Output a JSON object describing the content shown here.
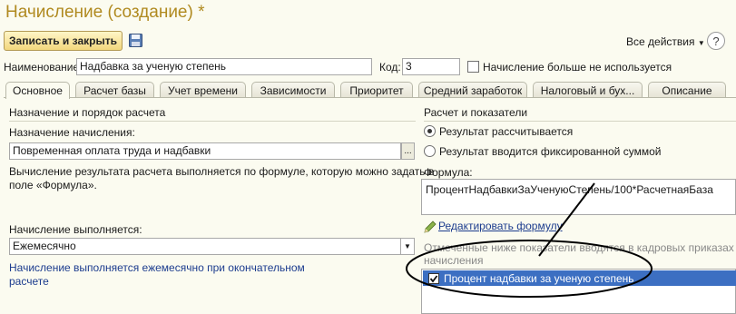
{
  "window": {
    "title": "Начисление (создание) *"
  },
  "toolbar": {
    "save_close_label": "Записать и закрыть",
    "all_actions_label": "Все действия",
    "help_label": "?"
  },
  "header_fields": {
    "name_label": "Наименование:",
    "name_value": "Надбавка за ученую степень",
    "code_label": "Код:",
    "code_value": "3",
    "unused_checkbox_label": "Начисление больше не используется"
  },
  "tabs": [
    {
      "label": "Основное",
      "active": true
    },
    {
      "label": "Расчет базы",
      "active": false
    },
    {
      "label": "Учет времени",
      "active": false
    },
    {
      "label": "Зависимости",
      "active": false
    },
    {
      "label": "Приоритет",
      "active": false
    },
    {
      "label": "Средний заработок",
      "active": false
    },
    {
      "label": "Налоговый и бух...",
      "active": false
    },
    {
      "label": "Описание",
      "active": false
    }
  ],
  "left_panel": {
    "section_title": "Назначение и порядок расчета",
    "purpose_label": "Назначение начисления:",
    "purpose_value": "Повременная оплата труда и надбавки",
    "formula_desc_line1": "Вычисление результата расчета выполняется по формуле, которую можно задать в",
    "formula_desc_line2": "поле «Формула».",
    "frequency_label": "Начисление выполняется:",
    "frequency_value": "Ежемесячно",
    "frequency_desc_line1": "Начисление выполняется ежемесячно при окончательном",
    "frequency_desc_line2": "расчете",
    "ellipsis": "..."
  },
  "right_panel": {
    "section_title": "Расчет и показатели",
    "radio_calculated": "Результат рассчитывается",
    "radio_fixed": "Результат вводится фиксированной суммой",
    "formula_label": "Формула:",
    "formula_value": "ПроцентНадбавкиЗаУченуюСтепень/100*РасчетнаяБаза",
    "edit_formula_link": "Редактировать формулу",
    "note_line1": "Отмеченные ниже показатели вводятся в кадровых приказах пр",
    "note_line2": "начисления",
    "indicators": [
      {
        "label": "Процент надбавки за ученую степень",
        "checked": true
      }
    ]
  },
  "colors": {
    "title": "#b08a20",
    "selection": "#3c6fc2",
    "link": "#1c3c8e"
  }
}
